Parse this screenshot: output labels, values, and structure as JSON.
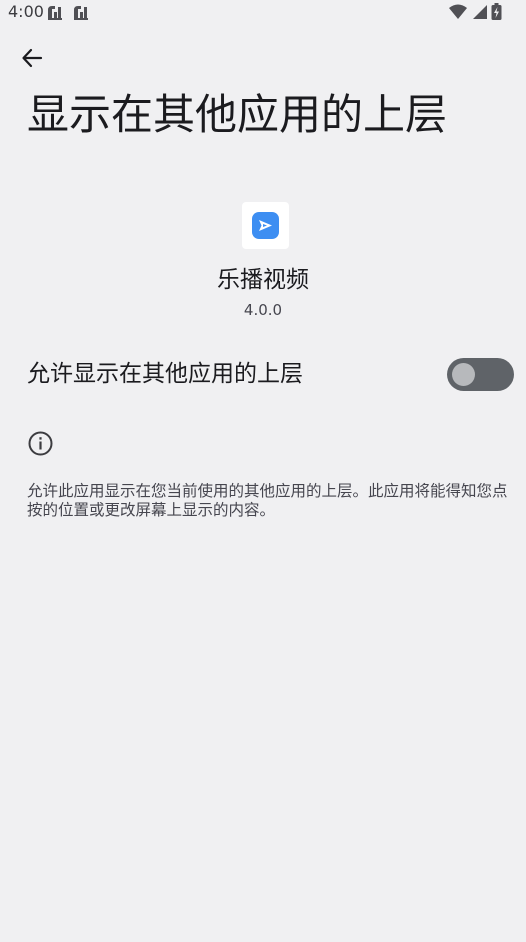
{
  "status_bar": {
    "time": "4:00",
    "notification_icons": [
      "app-notification-icon",
      "app-notification-icon"
    ],
    "right_icons": [
      "wifi-icon",
      "cellular-signal-icon",
      "battery-charging-icon"
    ]
  },
  "header": {
    "back_icon": "arrow-back-icon",
    "title": "显示在其他应用的上层"
  },
  "app": {
    "icon": "play-logo-icon",
    "icon_color": "#3d8ef2",
    "name": "乐播视频",
    "version": "4.0.0"
  },
  "permission": {
    "toggle_label": "允许显示在其他应用的上层",
    "enabled": false
  },
  "info": {
    "icon": "info-icon",
    "text": "允许此应用显示在您当前使用的其他应用的上层。此应用将能得知您点按的位置或更改屏幕上显示的内容。"
  },
  "colors": {
    "background": "#f0f0f2",
    "switch_track_off": "#5f6368",
    "switch_thumb_off": "#b7b9bc"
  }
}
